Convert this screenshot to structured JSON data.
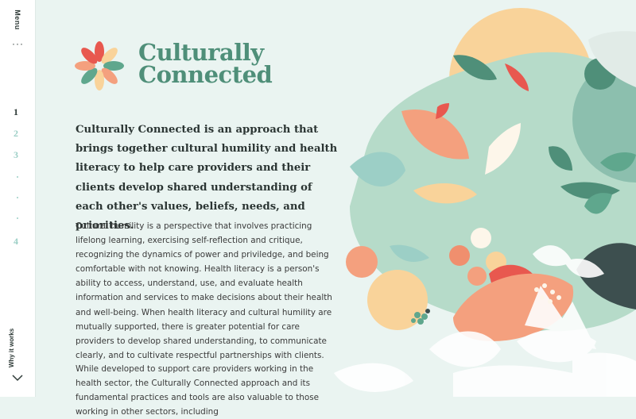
{
  "sidebar": {
    "menu_label": "Menu",
    "pages": [
      "1",
      "2",
      "3",
      "4"
    ],
    "why_label": "Why it works"
  },
  "brand": {
    "line1": "Culturally",
    "line2": "Connected"
  },
  "content": {
    "lead": "Culturally Connected is an approach that brings together cultural humility and health literacy to help care providers and their clients develop shared understanding of each other's values, beliefs, needs, and priorities.",
    "paragraph1": "Cultural humility is a perspective that involves practicing lifelong learning, exercising self-reflection and critique, recognizing the dynamics of power and priviledge, and being comfortable with not knowing. Health literacy is a person's ability to access, understand, use, and evaluate health information and services to make decisions about their health and well-being. When health literacy and cultural humility are mutually supported, there is greater potential for care providers to develop shared understanding, to communicate clearly, and to cultivate respectful partnerships with clients.",
    "paragraph2": "While developed to support care providers working in the health sector, the Culturally Connected approach and its fundamental practices and tools are also valuable to those working in other sectors, including"
  },
  "colors": {
    "background": "#eaf4f1",
    "brand_green": "#4f8f79",
    "accent_teal": "#9ccfc6",
    "coral": "#f4a07e",
    "peach": "#f9d39a",
    "red": "#e8584f",
    "dark_slate": "#3d4f4f"
  },
  "icons": [
    "menu-dots-icon",
    "chevron-down-icon",
    "flower-logo-icon"
  ]
}
